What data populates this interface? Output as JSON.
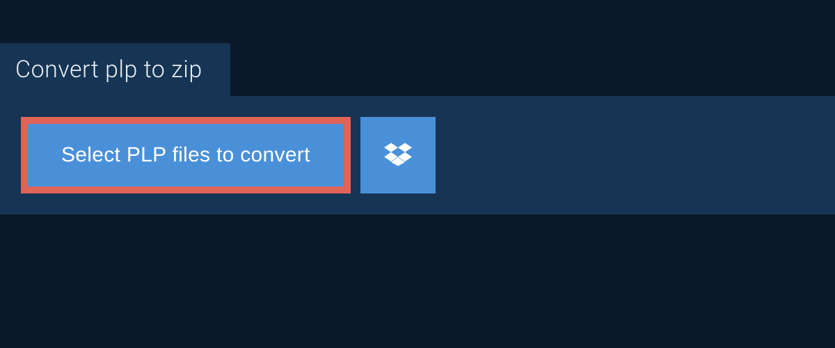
{
  "tab": {
    "label": "Convert plp to zip"
  },
  "buttons": {
    "select_label": "Select PLP files to convert"
  }
}
